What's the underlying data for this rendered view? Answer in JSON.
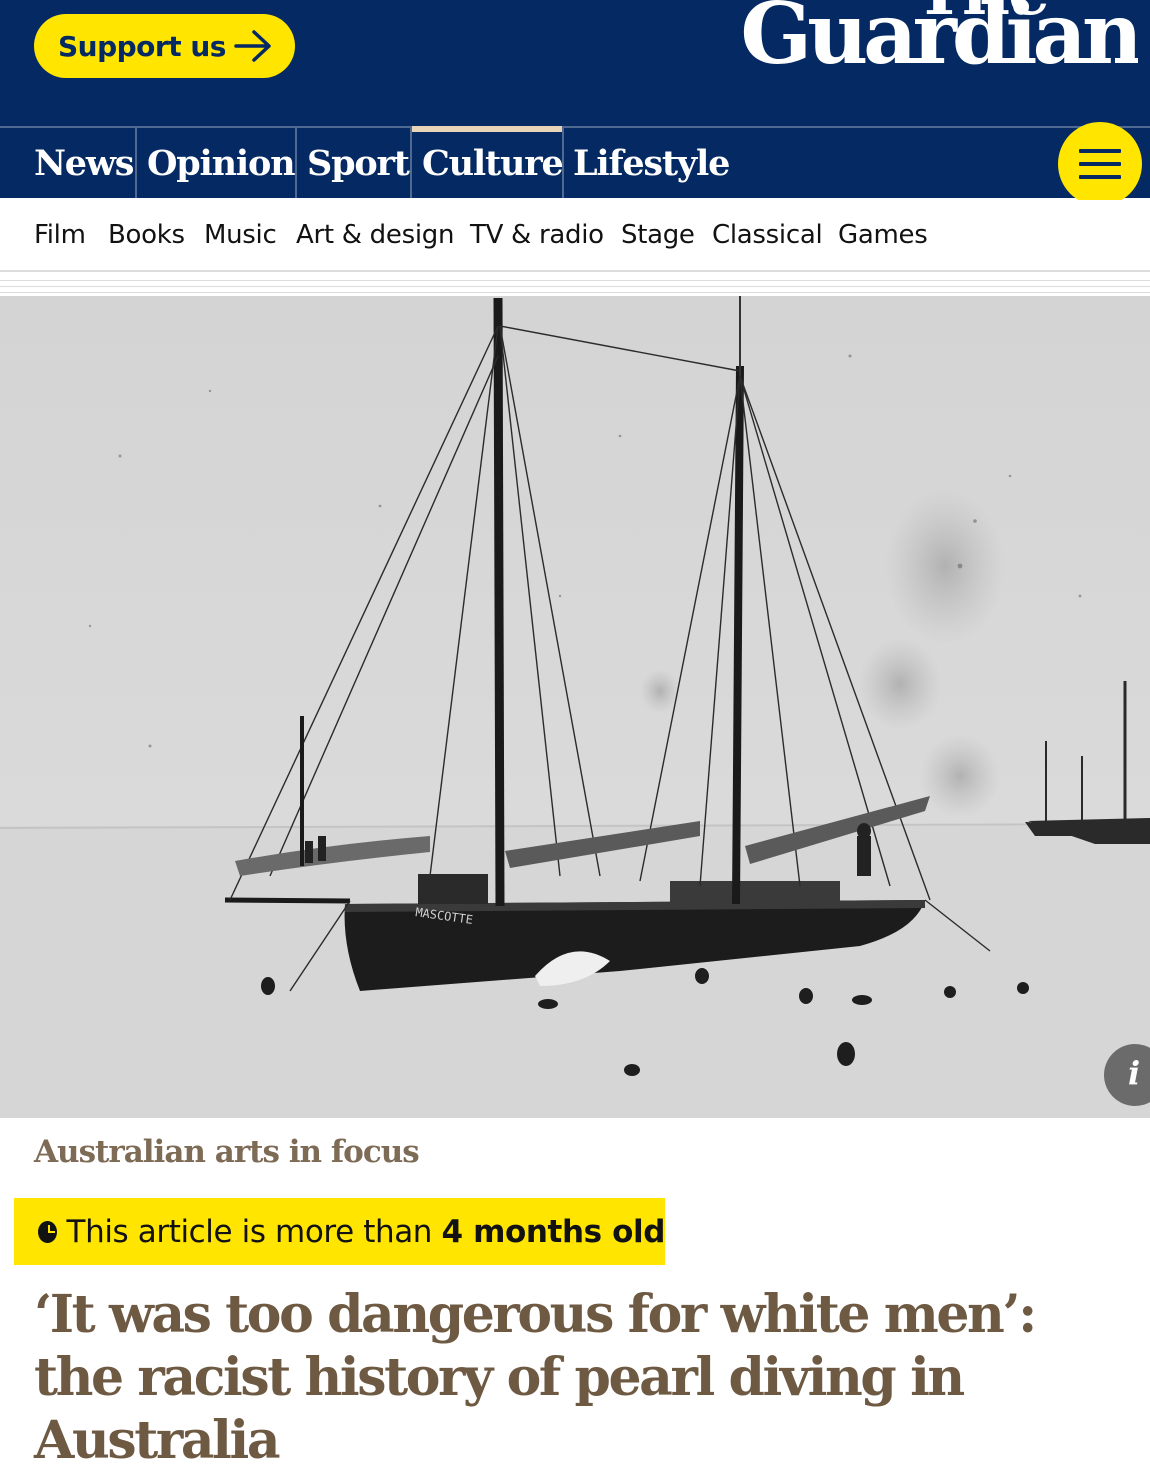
{
  "header": {
    "support_label": "Support us",
    "logo_the": "The",
    "logo_name": "Guardian"
  },
  "pillars": [
    {
      "label": "News"
    },
    {
      "label": "Opinion"
    },
    {
      "label": "Sport"
    },
    {
      "label": "Culture",
      "active": true
    },
    {
      "label": "Lifestyle"
    }
  ],
  "subnav": [
    "Film",
    "Books",
    "Music",
    "Art & design",
    "TV & radio",
    "Stage",
    "Classical",
    "Games"
  ],
  "article": {
    "kicker": "Australian arts in focus",
    "age_prefix": "This article is more than ",
    "age_bold": "4 months old",
    "headline": "‘It was too dangerous for white men’: the racist history of pearl diving in Australia",
    "boat_marking": "MASCOTTE"
  },
  "colors": {
    "brand_blue": "#052962",
    "yellow": "#ffe500",
    "culture_accent": "#e7d4b9",
    "culture_text": "#6e5a43",
    "kicker": "#7d6b56"
  },
  "icons": {
    "support_arrow": "arrow-right-icon",
    "menu": "hamburger-menu-icon",
    "info": "info-icon",
    "clock": "clock-icon"
  }
}
